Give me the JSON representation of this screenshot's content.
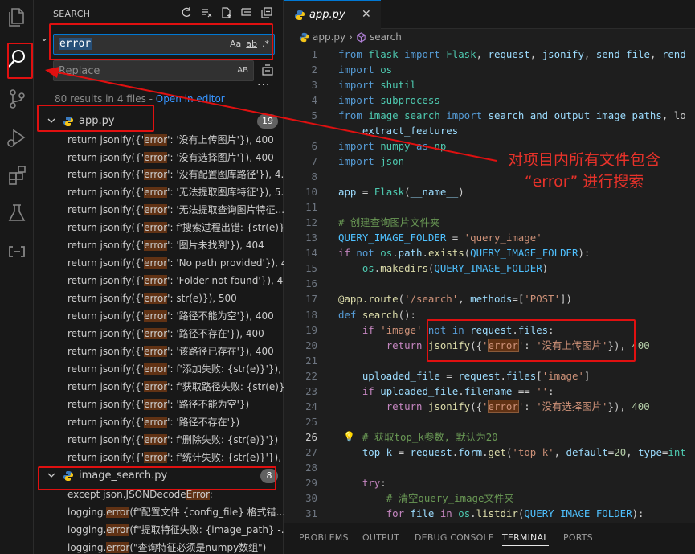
{
  "sidebar": {
    "title": "SEARCH",
    "search_value": "error",
    "opt_case": "Aa",
    "opt_word": "ab",
    "opt_regex": ".*",
    "replace_placeholder": "Replace",
    "replace_ab": "AB",
    "summary": "80 results in 4 files - ",
    "summary_link": "Open in editor",
    "files": [
      {
        "name": "app.py",
        "count": "19",
        "matches": [
          [
            "return jsonify({'",
            "error",
            "': '没有上传图片'}), 400"
          ],
          [
            "return jsonify({'",
            "error",
            "': '没有选择图片'}), 400"
          ],
          [
            "return jsonify({'",
            "error",
            "': '没有配置图库路径'}), 4..."
          ],
          [
            "return jsonify({'",
            "error",
            "': '无法提取图库特征'}), 5..."
          ],
          [
            "return jsonify({'",
            "error",
            "': '无法提取查询图片特征..."
          ],
          [
            "return jsonify({'",
            "error",
            "': f'搜索过程出错: {str(e)}'..."
          ],
          [
            "return jsonify({'",
            "error",
            "': '图片未找到'}), 404"
          ],
          [
            "return jsonify({'",
            "error",
            "': 'No path provided'}), 400"
          ],
          [
            "return jsonify({'",
            "error",
            "': 'Folder not found'}), 404"
          ],
          [
            "return jsonify({'",
            "error",
            "': str(e)}), 500"
          ],
          [
            "return jsonify({'",
            "error",
            "': '路径不能为空'}), 400"
          ],
          [
            "return jsonify({'",
            "error",
            "': '路径不存在'}), 400"
          ],
          [
            "return jsonify({'",
            "error",
            "': '该路径已存在'}), 400"
          ],
          [
            "return jsonify({'",
            "error",
            "': f'添加失败: {str(e)}'}), 500"
          ],
          [
            "return jsonify({'",
            "error",
            "': f'获取路径失败: {str(e)}'..."
          ],
          [
            "return jsonify({'",
            "error",
            "': '路径不能为空'})"
          ],
          [
            "return jsonify({'",
            "error",
            "': '路径不存在'})"
          ],
          [
            "return jsonify({'",
            "error",
            "': f'删除失败: {str(e)}'})"
          ],
          [
            "return jsonify({'",
            "error",
            "': f'统计失败: {str(e)}'}), 500"
          ]
        ]
      },
      {
        "name": "image_search.py",
        "count": "8",
        "matches": [
          [
            "except json.JSONDecode",
            "Error",
            ":"
          ],
          [
            "logging.",
            "error",
            "(f\"配置文件 {config_file} 格式错..."
          ],
          [
            "logging.",
            "error",
            "(f\"提取特征失败: {image_path} -..."
          ],
          [
            "logging.",
            "error",
            "(\"查询特征必须是numpy数组\")"
          ]
        ]
      }
    ]
  },
  "editor": {
    "tab_name": "app.py",
    "close_glyph": "✕",
    "breadcrumb_file": "app.py",
    "breadcrumb_symbol": "search",
    "current_line": 26,
    "lines": [
      {
        "n": "1",
        "t": [
          [
            "k",
            "from "
          ],
          [
            "m",
            "flask "
          ],
          [
            "k",
            "import "
          ],
          [
            "m",
            "Flask"
          ],
          [
            "",
            ","
          ],
          [
            "v",
            " request"
          ],
          [
            "",
            ", "
          ],
          [
            "v",
            "jsonify"
          ],
          [
            "",
            ", "
          ],
          [
            "v",
            "send_file"
          ],
          [
            "",
            ", "
          ],
          [
            "v",
            "rend"
          ]
        ]
      },
      {
        "n": "2",
        "t": [
          [
            "k",
            "import "
          ],
          [
            "m",
            "os"
          ]
        ]
      },
      {
        "n": "3",
        "t": [
          [
            "k",
            "import "
          ],
          [
            "m",
            "shutil"
          ]
        ]
      },
      {
        "n": "4",
        "t": [
          [
            "k",
            "import "
          ],
          [
            "m",
            "subprocess"
          ]
        ]
      },
      {
        "n": "5",
        "t": [
          [
            "k",
            "from "
          ],
          [
            "m",
            "image_search "
          ],
          [
            "k",
            "import "
          ],
          [
            "v",
            "search_and_output_image_paths"
          ],
          [
            "",
            ", lo"
          ]
        ]
      },
      {
        "n": "",
        "t": [
          [
            "",
            "    "
          ],
          [
            "v",
            "extract_features"
          ]
        ]
      },
      {
        "n": "6",
        "t": [
          [
            "k",
            "import "
          ],
          [
            "m",
            "numpy "
          ],
          [
            "k",
            "as "
          ],
          [
            "m",
            "np"
          ]
        ]
      },
      {
        "n": "7",
        "t": [
          [
            "k",
            "import "
          ],
          [
            "m",
            "json"
          ]
        ]
      },
      {
        "n": "8",
        "t": []
      },
      {
        "n": "10",
        "t": [
          [
            "v",
            "app"
          ],
          [
            "",
            " = "
          ],
          [
            "m",
            "Flask"
          ],
          [
            "",
            "("
          ],
          [
            "v",
            "__name__"
          ],
          [
            "",
            ")"
          ]
        ]
      },
      {
        "n": "11",
        "t": []
      },
      {
        "n": "12",
        "t": [
          [
            "c",
            "# 创建查询图片文件夹"
          ]
        ]
      },
      {
        "n": "13",
        "t": [
          [
            "cn",
            "QUERY_IMAGE_FOLDER"
          ],
          [
            "",
            " = "
          ],
          [
            "s",
            "'query_image'"
          ]
        ]
      },
      {
        "n": "14",
        "t": [
          [
            "kc",
            "if "
          ],
          [
            "k",
            "not "
          ],
          [
            "m",
            "os"
          ],
          [
            "",
            "."
          ],
          [
            "v",
            "path"
          ],
          [
            "",
            "."
          ],
          [
            "f",
            "exists"
          ],
          [
            "",
            "("
          ],
          [
            "cn",
            "QUERY_IMAGE_FOLDER"
          ],
          [
            "",
            "):"
          ]
        ]
      },
      {
        "n": "15",
        "t": [
          [
            "",
            "    "
          ],
          [
            "m",
            "os"
          ],
          [
            "",
            "."
          ],
          [
            "f",
            "makedirs"
          ],
          [
            "",
            "("
          ],
          [
            "cn",
            "QUERY_IMAGE_FOLDER"
          ],
          [
            "",
            ")"
          ]
        ]
      },
      {
        "n": "16",
        "t": []
      },
      {
        "n": "17",
        "t": [
          [
            "d",
            "@app.route"
          ],
          [
            "",
            "("
          ],
          [
            "s",
            "'/search'"
          ],
          [
            "",
            ", "
          ],
          [
            "v",
            "methods"
          ],
          [
            "",
            "=["
          ],
          [
            "s",
            "'POST'"
          ],
          [
            "",
            "])"
          ]
        ]
      },
      {
        "n": "18",
        "t": [
          [
            "k",
            "def "
          ],
          [
            "f",
            "search"
          ],
          [
            "",
            "():"
          ]
        ]
      },
      {
        "n": "19",
        "t": [
          [
            "",
            "    "
          ],
          [
            "kc",
            "if "
          ],
          [
            "s",
            "'image' "
          ],
          [
            "k",
            "not in "
          ],
          [
            "v",
            "request"
          ],
          [
            "",
            "."
          ],
          [
            "v",
            "files"
          ],
          [
            "",
            ":"
          ]
        ]
      },
      {
        "n": "20",
        "t": [
          [
            "",
            "        "
          ],
          [
            "kc",
            "return "
          ],
          [
            "f",
            "jsonify"
          ],
          [
            "",
            "({"
          ],
          [
            "s",
            "'"
          ],
          [
            "hs",
            "error"
          ],
          [
            "s",
            "'"
          ],
          [
            "",
            ": "
          ],
          [
            "s",
            "'没有上传图片'"
          ],
          [
            "",
            "}), "
          ],
          [
            "n",
            "400"
          ]
        ]
      },
      {
        "n": "21",
        "t": []
      },
      {
        "n": "22",
        "t": [
          [
            "",
            "    "
          ],
          [
            "v",
            "uploaded_file"
          ],
          [
            "",
            " = "
          ],
          [
            "v",
            "request"
          ],
          [
            "",
            "."
          ],
          [
            "v",
            "files"
          ],
          [
            "",
            "["
          ],
          [
            "s",
            "'image'"
          ],
          [
            "",
            "]"
          ]
        ]
      },
      {
        "n": "23",
        "t": [
          [
            "",
            "    "
          ],
          [
            "kc",
            "if "
          ],
          [
            "v",
            "uploaded_file"
          ],
          [
            "",
            "."
          ],
          [
            "v",
            "filename"
          ],
          [
            "",
            " == "
          ],
          [
            "s",
            "''"
          ],
          [
            "",
            ":"
          ]
        ]
      },
      {
        "n": "24",
        "t": [
          [
            "",
            "        "
          ],
          [
            "kc",
            "return "
          ],
          [
            "f",
            "jsonify"
          ],
          [
            "",
            "({"
          ],
          [
            "s",
            "'"
          ],
          [
            "hs",
            "error"
          ],
          [
            "s",
            "'"
          ],
          [
            "",
            ": "
          ],
          [
            "s",
            "'没有选择图片'"
          ],
          [
            "",
            "}), "
          ],
          [
            "n",
            "400"
          ]
        ]
      },
      {
        "n": "25",
        "t": []
      },
      {
        "n": "26",
        "t": [
          [
            "",
            "    "
          ],
          [
            "c",
            "# 获取top_k参数, 默认为20"
          ]
        ]
      },
      {
        "n": "27",
        "t": [
          [
            "",
            "    "
          ],
          [
            "v",
            "top_k"
          ],
          [
            "",
            " = "
          ],
          [
            "v",
            "request"
          ],
          [
            "",
            "."
          ],
          [
            "v",
            "form"
          ],
          [
            "",
            "."
          ],
          [
            "f",
            "get"
          ],
          [
            "",
            "("
          ],
          [
            "s",
            "'top_k'"
          ],
          [
            "",
            ", "
          ],
          [
            "v",
            "default"
          ],
          [
            "",
            "="
          ],
          [
            "n",
            "20"
          ],
          [
            "",
            ", "
          ],
          [
            "v",
            "type"
          ],
          [
            "",
            "="
          ],
          [
            "m",
            "int"
          ]
        ]
      },
      {
        "n": "28",
        "t": []
      },
      {
        "n": "29",
        "t": [
          [
            "",
            "    "
          ],
          [
            "kc",
            "try"
          ],
          [
            "",
            ":"
          ]
        ]
      },
      {
        "n": "30",
        "t": [
          [
            "",
            "        "
          ],
          [
            "c",
            "# 清空query_image文件夹"
          ]
        ]
      },
      {
        "n": "31",
        "t": [
          [
            "",
            "        "
          ],
          [
            "kc",
            "for "
          ],
          [
            "v",
            "file "
          ],
          [
            "kc",
            "in "
          ],
          [
            "m",
            "os"
          ],
          [
            "",
            "."
          ],
          [
            "f",
            "listdir"
          ],
          [
            "",
            "("
          ],
          [
            "cn",
            "QUERY_IMAGE_FOLDER"
          ],
          [
            "",
            "):"
          ]
        ]
      }
    ]
  },
  "panel": {
    "tabs": [
      "PROBLEMS",
      "OUTPUT",
      "DEBUG CONSOLE",
      "TERMINAL",
      "PORTS"
    ],
    "active": "TERMINAL"
  },
  "annotation": {
    "line1": "对项目内所有文件包含",
    "line2": "“error”  进行搜索",
    "color": "#e8322a"
  },
  "colors": {
    "accent": "#0078d4",
    "match_highlight": "#613214",
    "annotation_red": "#e01010"
  }
}
